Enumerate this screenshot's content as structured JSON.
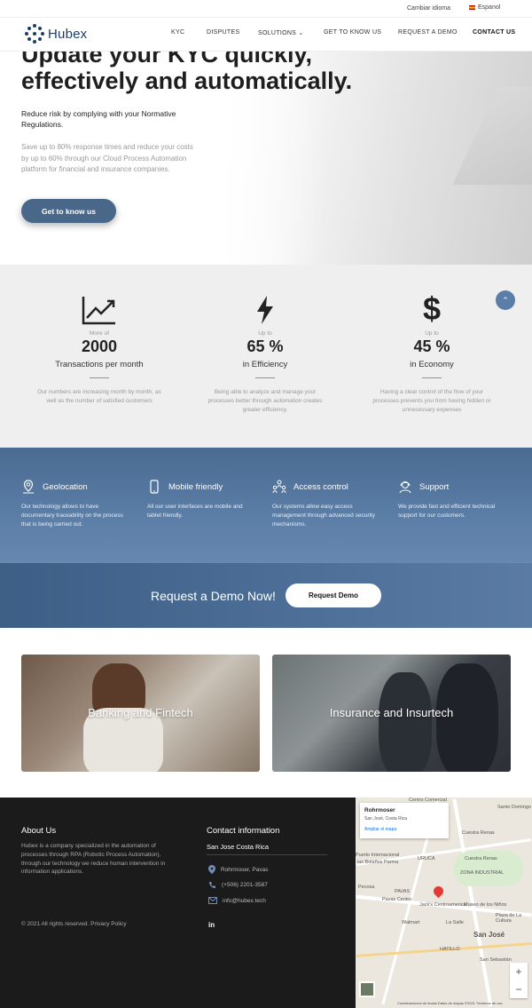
{
  "topbar": {
    "change_language": "Cambiar idioma",
    "language": "Espanol"
  },
  "nav": {
    "logo": "Hubex",
    "items": [
      "KYC",
      "DISPUTES",
      "SOLUTIONS",
      "GET TO KNOW US",
      "REQUEST A DEMO",
      "CONTACT US"
    ]
  },
  "hero": {
    "title": "Update your KYC quickly, effectively and automatically.",
    "lead": "Reduce risk by complying with your Normative Regulations.",
    "desc": "Save up to 80% response times and reduce your costs by up to 60% through our Cloud Process Automation platform for financial and insurance companies.",
    "cta": "Get to know us"
  },
  "stats": [
    {
      "icon": "chart-icon",
      "pre": "More of",
      "value": "2000",
      "label": "Transactions per month",
      "text": "Our numbers are increasing month by month, as well as the number of satisfied customers"
    },
    {
      "icon": "lightning-icon",
      "pre": "Up to",
      "value": "65 %",
      "label": "in Efficiency",
      "text": "Being able to analyze and manage your processes better through automation creates greater efficiency."
    },
    {
      "icon": "dollar-icon",
      "pre": "Up to",
      "value": "45 %",
      "label": "in Economy",
      "text": "Having a clear control of the flow of your processes prevents you from having hidden or unnecessary expenses"
    }
  ],
  "features": [
    {
      "icon": "location-icon",
      "title": "Geolocation",
      "text": "Our technology allows to have documentary traceability on the process that is being carried out."
    },
    {
      "icon": "mobile-icon",
      "title": "Mobile friendly",
      "text": "All our user interfaces are mobile and tablet friendly."
    },
    {
      "icon": "access-control-icon",
      "title": "Access control",
      "text": "Our systems allow easy access management through advanced security mechanisms."
    },
    {
      "icon": "support-icon",
      "title": "Support",
      "text": "We provide fast and efficient technical support for our customers."
    }
  ],
  "demo": {
    "text": "Request a Demo Now!",
    "button": "Request Demo"
  },
  "cards": [
    "Banking and Fintech",
    "Insurance and Insurtech"
  ],
  "footer": {
    "about_title": "About Us",
    "about_text": "Hubex is a company specialized in the automation of processes through RPA (Robotic Process Automation), through our technology we reduce human intervention in information applications.",
    "contact_title": "Contact information",
    "city": "San Jose Costa Rica",
    "address": "Rohrmoser, Pavas",
    "phone": "(+506) 2201-3587",
    "email": "info@hubex.tech",
    "copyright": "©  2021 All rights reserved. Privacy Policy"
  },
  "map": {
    "place": "Rohrmoser",
    "place_address": "San José, Costa Rica",
    "open_link": "Ampliar el mapa",
    "labels": [
      "Centro Comercial",
      "Santo Domingo",
      "Cuestra Renas",
      "Puerto Internacional",
      "ias Bolaños Parma",
      "URUCA",
      "Cuestra Renas",
      "Pecosa",
      "PAVAS",
      "ZONA INDUSTRIAL",
      "Pavas Centro",
      "Jack's Centroamerica",
      "Museo de los Niños",
      "Walmart",
      "La Salle",
      "Plaza de La Cultura",
      "San José",
      "HATILLO",
      "San Sebastián"
    ],
    "footer": "Combinaciones de teclas   Datos de mapas ©2021   Términos de uso"
  }
}
